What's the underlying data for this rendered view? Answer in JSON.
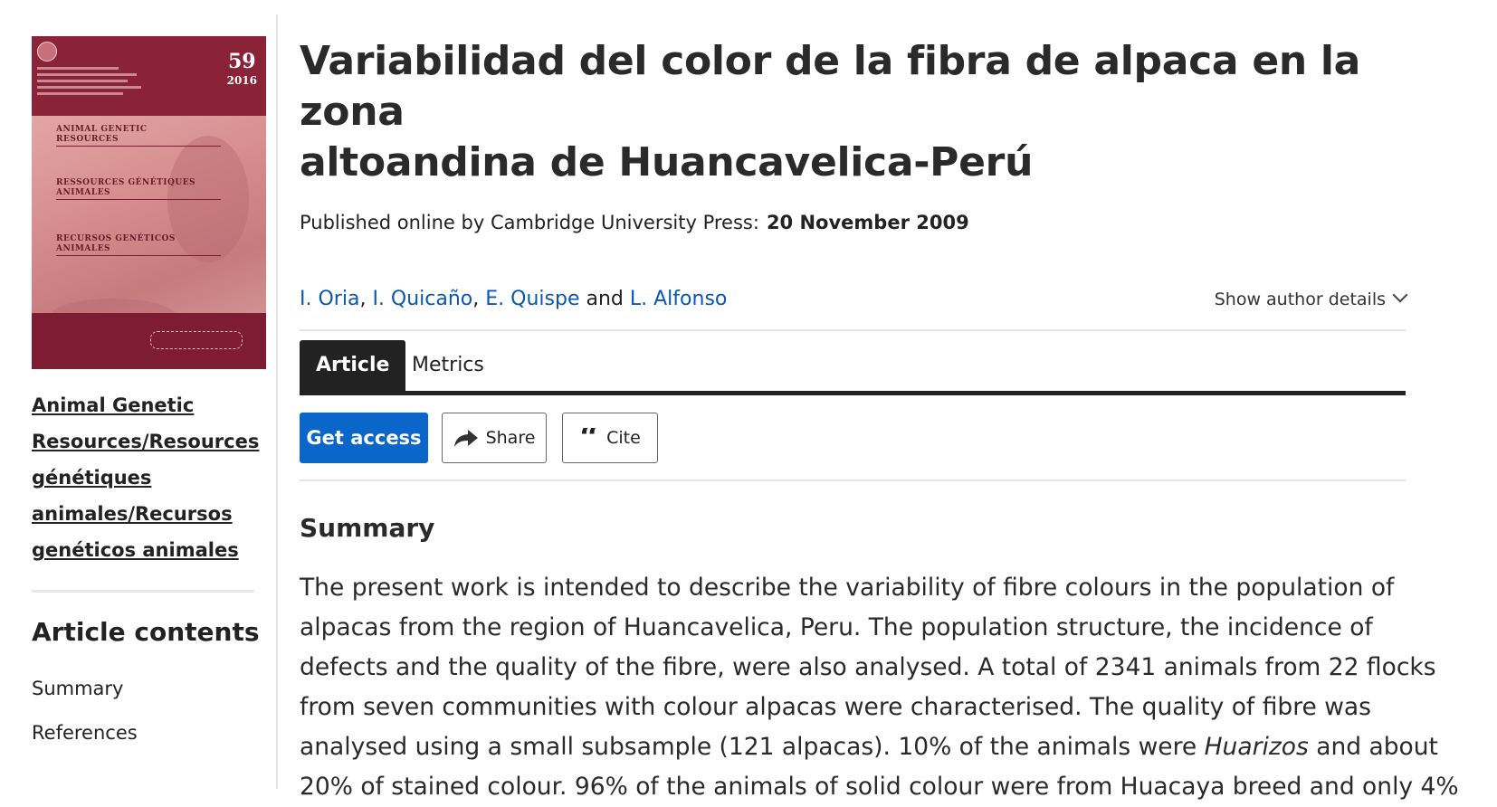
{
  "sidebar": {
    "cover": {
      "issue_number": "59",
      "issue_year": "2016",
      "section_1": "ANIMAL GENETIC RESOURCES",
      "section_2": "RESSOURCES GÉNÉTIQUES ANIMALES",
      "section_3": "RECURSOS GENÉTICOS ANIMALES"
    },
    "journal_link_lines": [
      "Animal Genetic",
      "Resources/Resources",
      "génétiques",
      "animales/Recursos",
      "genéticos animales"
    ],
    "contents_title": "Article contents",
    "contents_items": [
      "Summary",
      "References"
    ]
  },
  "article": {
    "title_lines": [
      "Variabilidad del color de la fibra de alpaca en la zona",
      "altoandina de Huancavelica-Perú"
    ],
    "published_label": "Published online by Cambridge University Press:",
    "published_date": "20 November 2009",
    "authors": [
      "I. Oria",
      "I. Quicaño",
      "E. Quispe",
      "L. Alfonso"
    ],
    "author_separators": [
      ",",
      ",",
      "and"
    ],
    "show_author_details": "Show author details",
    "tabs": [
      "Article",
      "Metrics"
    ],
    "actions": {
      "get_access": "Get access",
      "share": "Share",
      "cite": "Cite"
    },
    "summary_heading": "Summary",
    "abstract_lines": [
      {
        "pre": "The present work is intended to describe the variability of fibre colours in the population of",
        "em": "",
        "post": ""
      },
      {
        "pre": "alpacas from the region of Huancavelica, Peru. The population structure, the incidence of",
        "em": "",
        "post": ""
      },
      {
        "pre": "defects and the quality of the fibre, were also analysed. A total of 2341 animals from 22 flocks",
        "em": "",
        "post": ""
      },
      {
        "pre": "from seven communities with colour alpacas were characterised. The quality of fibre was",
        "em": "",
        "post": ""
      },
      {
        "pre": "analysed using a small subsample (121 alpacas). 10% of the animals were ",
        "em": "Huarizos",
        "post": " and about"
      },
      {
        "pre": "20% of stained colour. 96% of the animals of solid colour were from Huacaya breed and only 4%",
        "em": "",
        "post": ""
      }
    ]
  },
  "colors": {
    "link_blue": "#0a57b8",
    "access_button": "#0a66c9",
    "tab_active": "#222222",
    "cover_band": "#8a2338"
  }
}
